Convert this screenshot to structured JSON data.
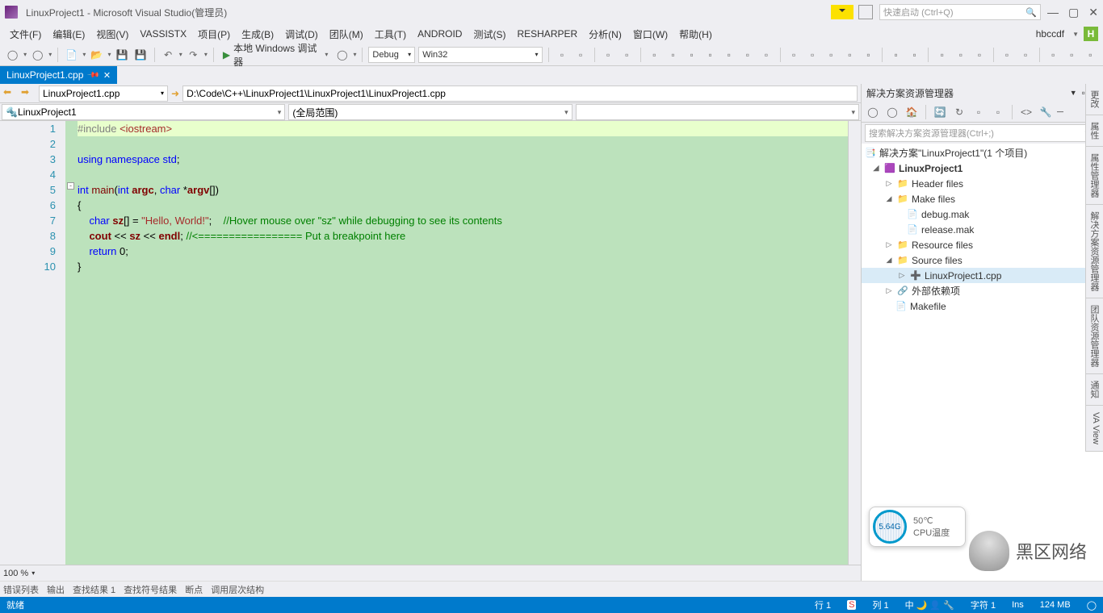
{
  "title": "LinuxProject1 - Microsoft Visual Studio(管理员)",
  "quick_launch_placeholder": "快速启动 (Ctrl+Q)",
  "menu": [
    "文件(F)",
    "编辑(E)",
    "视图(V)",
    "VASSISTX",
    "项目(P)",
    "生成(B)",
    "调试(D)",
    "团队(M)",
    "工具(T)",
    "ANDROID",
    "测试(S)",
    "RESHARPER",
    "分析(N)",
    "窗口(W)",
    "帮助(H)"
  ],
  "user": "hbccdf",
  "toolbar": {
    "debugger": "本地 Windows 调试器",
    "config": "Debug",
    "platform": "Win32"
  },
  "file_tab": "LinuxProject1.cpp",
  "nav_file": "LinuxProject1.cpp",
  "nav_path": "D:\\Code\\C++\\LinuxProject1\\LinuxProject1\\LinuxProject1.cpp",
  "scope": {
    "left": "LinuxProject1",
    "right": "(全局范围)"
  },
  "lines": [
    "1",
    "2",
    "3",
    "4",
    "5",
    "6",
    "7",
    "8",
    "9",
    "10"
  ],
  "zoom": "100 %",
  "bottom_tabs": [
    "错误列表",
    "输出",
    "查找结果 1",
    "查找符号结果",
    "断点",
    "调用层次结构"
  ],
  "right_panel": {
    "title": "解决方案资源管理器",
    "search_placeholder": "搜索解决方案资源管理器(Ctrl+;)",
    "root": "解决方案\"LinuxProject1\"(1 个项目)",
    "project": "LinuxProject1",
    "folders": {
      "header": "Header files",
      "make": "Make files",
      "debug_mak": "debug.mak",
      "release_mak": "release.mak",
      "resource": "Resource files",
      "source": "Source files",
      "src_file": "LinuxProject1.cpp",
      "ext_deps": "外部依赖项",
      "makefile": "Makefile"
    }
  },
  "side_tabs": [
    "更改",
    "属性",
    "属性管理器",
    "解决方案资源管理器",
    "团队资源管理器",
    "通知",
    "VA View"
  ],
  "gauge": {
    "mem": "5.64G",
    "temp": "50℃",
    "label": "CPU温度"
  },
  "watermark": "黑区网络",
  "status": {
    "ready": "就绪",
    "line": "行 1",
    "col": "列 1",
    "char": "字符 1",
    "ins": "Ins",
    "mem": "124 MB"
  }
}
